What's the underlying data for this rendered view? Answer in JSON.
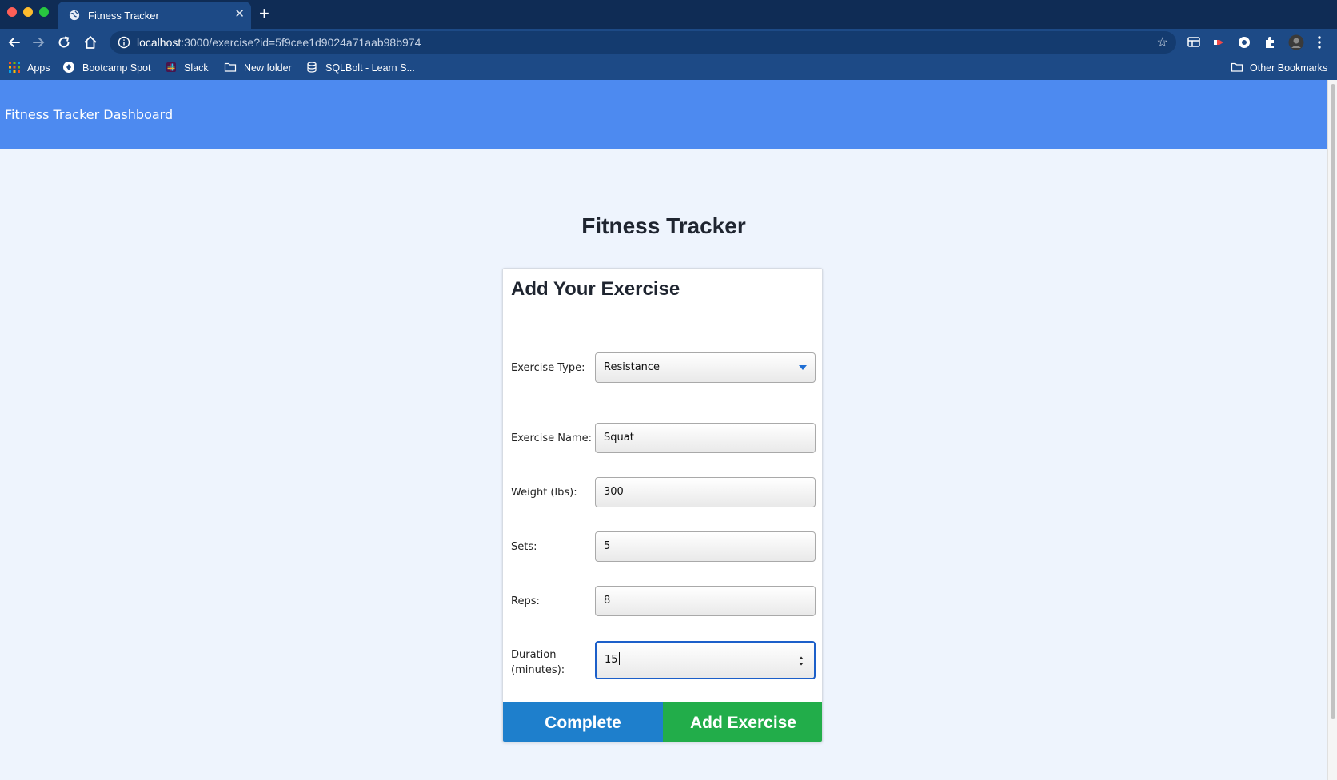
{
  "browser": {
    "tab_title": "Fitness Tracker",
    "url_host": "localhost",
    "url_rest": ":3000/exercise?id=5f9cee1d9024a71aab98b974",
    "bookmarks": [
      "Apps",
      "Bootcamp Spot",
      "Slack",
      "New folder",
      "SQLBolt - Learn S..."
    ],
    "other_bookmarks": "Other Bookmarks"
  },
  "navbar": {
    "brand": "Fitness Tracker Dashboard"
  },
  "page": {
    "title": "Fitness Tracker"
  },
  "form": {
    "title": "Add Your Exercise",
    "exercise_type": {
      "label": "Exercise Type:",
      "value": "Resistance"
    },
    "exercise_name": {
      "label": "Exercise Name:",
      "value": "Squat"
    },
    "weight": {
      "label": "Weight (lbs):",
      "value": "300"
    },
    "sets": {
      "label": "Sets:",
      "value": "5"
    },
    "reps": {
      "label": "Reps:",
      "value": "8"
    },
    "duration": {
      "label_line1": "Duration",
      "label_line2": "(minutes):",
      "value": "15"
    },
    "complete_label": "Complete",
    "add_label": "Add Exercise"
  },
  "colors": {
    "navbar": "#4d8af0",
    "complete_button": "#1e7fcc",
    "add_button": "#22ad4a",
    "page_background": "#eef4fd"
  }
}
